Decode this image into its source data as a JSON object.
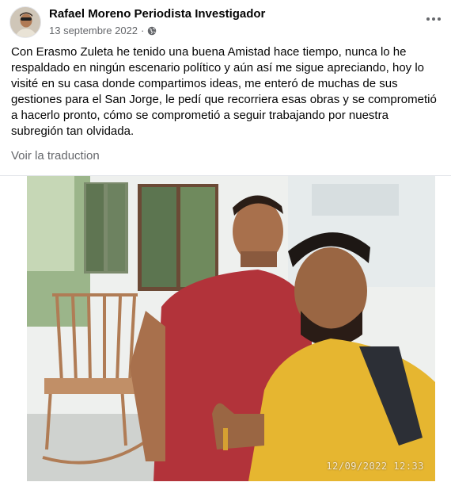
{
  "post": {
    "author": "Rafael Moreno Periodista Investigador",
    "date": "13 septembre 2022",
    "separator": "·",
    "privacy_icon": "globe-icon",
    "more_icon": "more-horizontal-icon",
    "body": "Con Erasmo Zuleta he tenido una buena Amistad hace tiempo, nunca lo he respaldado en ningún escenario político y aún así me sigue apreciando, hoy lo visité en su casa donde compartimos ideas, me enteró de muchas de sus gestiones para el San Jorge, le pedí que recorriera esas obras y se comprometió a hacerlo pronto,  cómo se comprometió a seguir trabajando por nuestra subregión tan olvidada.",
    "translate_label": "Voir la traduction"
  },
  "photo": {
    "timestamp": "12/09/2022  12:33"
  },
  "colors": {
    "text_primary": "#050505",
    "text_secondary": "#65676b",
    "divider": "#e4e6eb"
  }
}
